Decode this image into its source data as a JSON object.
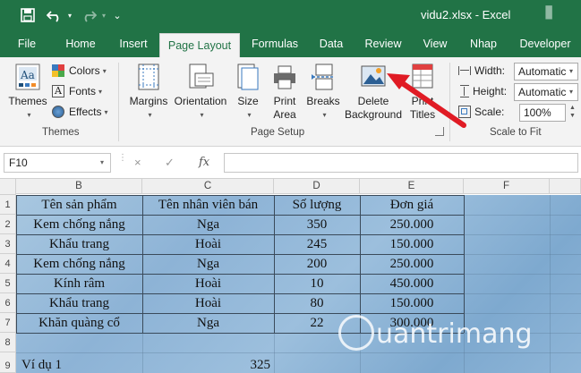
{
  "titlebar": {
    "document_title": "vidu2.xlsx  -  Excel",
    "bg_color": "#217346"
  },
  "tabs": [
    {
      "label": "File"
    },
    {
      "label": "Home"
    },
    {
      "label": "Insert"
    },
    {
      "label": "Page Layout",
      "active": true
    },
    {
      "label": "Formulas"
    },
    {
      "label": "Data"
    },
    {
      "label": "Review"
    },
    {
      "label": "View"
    },
    {
      "label": "Nhap"
    },
    {
      "label": "Developer"
    }
  ],
  "ribbon": {
    "themes_group": {
      "themes_label": "Themes",
      "colors_label": "Colors",
      "fonts_label": "Fonts",
      "effects_label": "Effects",
      "group_label": "Themes"
    },
    "page_setup_group": {
      "margins_label": "Margins",
      "orientation_label": "Orientation",
      "size_label": "Size",
      "print_area_label": "Print Area",
      "breaks_label": "Breaks",
      "delete_background_label": "Delete Background",
      "print_titles_label": "Print Titles",
      "group_label": "Page Setup"
    },
    "scale_group": {
      "width_label": "Width:",
      "width_value": "Automatic",
      "height_label": "Height:",
      "height_value": "Automatic",
      "scale_label": "Scale:",
      "scale_value": "100%",
      "group_label": "Scale to Fit"
    }
  },
  "formula_bar": {
    "name_box": "F10",
    "cancel_symbol": "×",
    "enter_symbol": "✓",
    "fx_symbol": "fx",
    "formula_value": ""
  },
  "grid": {
    "column_headers": [
      "B",
      "C",
      "D",
      "E",
      "F"
    ],
    "row_headers": [
      "1",
      "2",
      "3",
      "4",
      "5",
      "6",
      "7",
      "8",
      "9"
    ],
    "header_row": [
      "Tên sản phẩm",
      "Tên nhân viên bán",
      "Số lượng",
      "Đơn giá"
    ],
    "rows": [
      [
        "Kem chống nắng",
        "Nga",
        "350",
        "250.000"
      ],
      [
        "Khẩu trang",
        "Hoài",
        "245",
        "150.000"
      ],
      [
        "Kem chống nắng",
        "Nga",
        "200",
        "250.000"
      ],
      [
        "Kính râm",
        "Hoài",
        "10",
        "450.000"
      ],
      [
        "Khẩu trang",
        "Hoài",
        "80",
        "150.000"
      ],
      [
        "Khăn quàng cổ",
        "Nga",
        "22",
        "300.000"
      ]
    ],
    "row9": {
      "label": "Ví dụ 1",
      "value": "325"
    }
  },
  "watermark_text": "uantrimang",
  "colors": {
    "excel_green": "#217346",
    "annotation_arrow": "#e01b24"
  }
}
